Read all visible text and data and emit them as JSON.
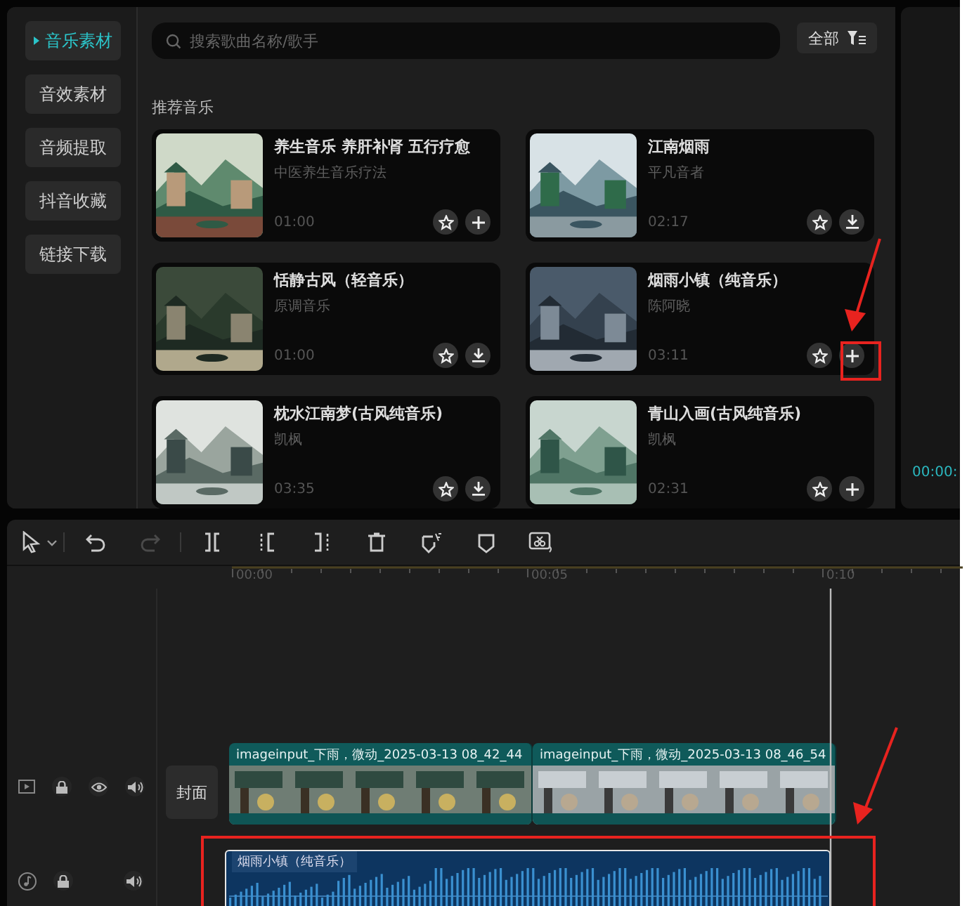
{
  "sidebar": {
    "items": [
      {
        "label": "音乐素材",
        "selected": true
      },
      {
        "label": "音效素材",
        "selected": false
      },
      {
        "label": "音频提取",
        "selected": false
      },
      {
        "label": "抖音收藏",
        "selected": false
      },
      {
        "label": "链接下载",
        "selected": false
      }
    ]
  },
  "search": {
    "placeholder": "搜索歌曲名称/歌手"
  },
  "filter_button": {
    "label": "全部"
  },
  "section_title": "推荐音乐",
  "tracks": [
    {
      "title": "养生音乐 养肝补肾 五行疗愈",
      "artist": "中医养生音乐疗法",
      "duration": "01:00",
      "kind": "add"
    },
    {
      "title": "江南烟雨",
      "artist": "平凡音者",
      "duration": "02:17",
      "kind": "download"
    },
    {
      "title": "恬静古风（轻音乐）",
      "artist": "原调音乐",
      "duration": "01:00",
      "kind": "download"
    },
    {
      "title": "烟雨小镇（纯音乐）",
      "artist": "陈阿晓",
      "duration": "03:11",
      "kind": "add"
    },
    {
      "title": "枕水江南梦(古风纯音乐)",
      "artist": "凯枫",
      "duration": "03:35",
      "kind": "download"
    },
    {
      "title": "青山入画(古风纯音乐)",
      "artist": "凯枫",
      "duration": "02:31",
      "kind": "add"
    }
  ],
  "preview": {
    "timecode": "00:00:"
  },
  "toolbar": [
    {
      "kind": "select",
      "disabled": false
    },
    {
      "kind": "undo",
      "disabled": false
    },
    {
      "kind": "redo",
      "disabled": true
    },
    {
      "kind": "split",
      "disabled": false
    },
    {
      "kind": "split-left",
      "disabled": false
    },
    {
      "kind": "split-right",
      "disabled": false
    },
    {
      "kind": "delete",
      "disabled": false
    },
    {
      "kind": "ai-marker",
      "disabled": false
    },
    {
      "kind": "marker",
      "disabled": false
    },
    {
      "kind": "audio-cut",
      "disabled": false
    }
  ],
  "ruler": [
    "00:00",
    "00:05",
    "0:10"
  ],
  "video_track": {
    "cover_label": "封面",
    "clips": [
      {
        "label": "imageinput_下雨，微动_2025-03-13 08_42_44"
      },
      {
        "label": "imageinput_下雨，微动_2025-03-13 08_46_54"
      }
    ]
  },
  "audio_track": {
    "clip_label": "烟雨小镇（纯音乐）"
  }
}
